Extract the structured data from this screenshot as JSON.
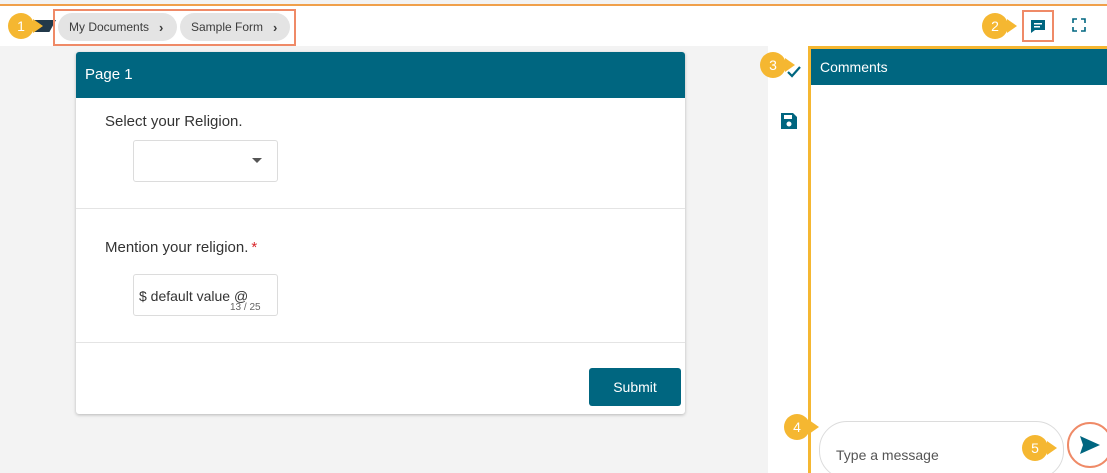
{
  "breadcrumb": {
    "items": [
      {
        "label": "My Documents"
      },
      {
        "label": "Sample Form"
      }
    ]
  },
  "callouts": [
    "1",
    "2",
    "3",
    "4",
    "5"
  ],
  "form": {
    "page_title": "Page 1",
    "question1": {
      "label": "Select your Religion.",
      "selected": ""
    },
    "question2": {
      "label": "Mention your religion.",
      "required_mark": "*",
      "value": "$ default value  @",
      "counter": "13 / 25"
    },
    "submit_label": "Submit"
  },
  "side_icons": [
    "check-icon",
    "save-icon"
  ],
  "comments": {
    "title": "Comments",
    "placeholder": "Type a message"
  },
  "colors": {
    "primary": "#006680",
    "callout": "#f5b731",
    "highlight": "#ef8a67",
    "required": "#d9262b"
  }
}
